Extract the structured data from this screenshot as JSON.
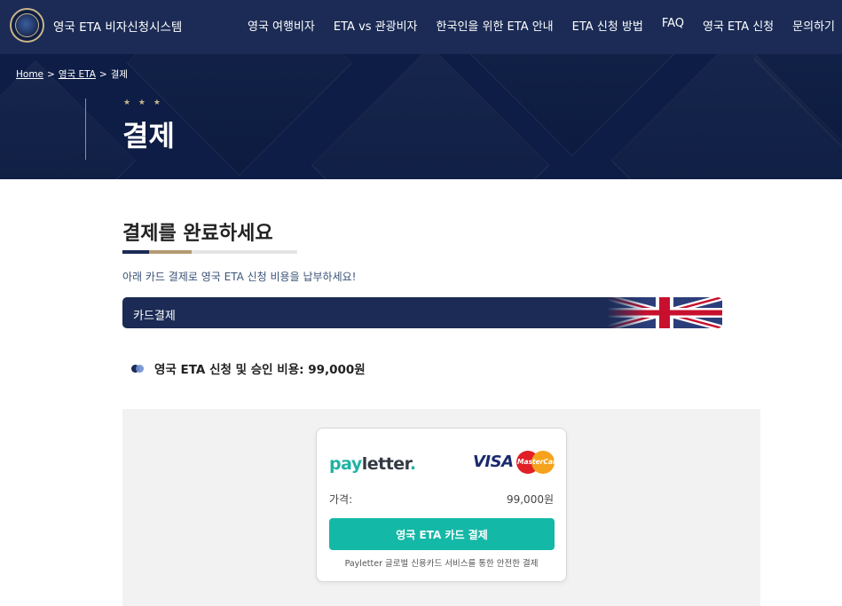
{
  "header": {
    "brand": "영국 ETA 비자신청시스템",
    "nav": [
      "영국 여행비자",
      "ETA vs 관광비자",
      "한국인을 위한 ETA 안내",
      "ETA 신청 방법",
      "FAQ",
      "영국 ETA 신청",
      "문의하기"
    ]
  },
  "hero": {
    "breadcrumb": {
      "home": "Home",
      "sep": ">",
      "eta": "영국 ETA",
      "current": "결제"
    },
    "stars": "★ ★ ★",
    "title": "결제"
  },
  "main": {
    "title": "결제를 완료하세요",
    "description": "아래 카드 결제로 영국 ETA 신청 비용을 납부하세요!",
    "card_section_label": "카드결제",
    "fee_text": "영국 ETA 신청 및 승인 비용: 99,000원"
  },
  "payment": {
    "provider_pay": "pay",
    "provider_letter": "letter",
    "provider_dot": ".",
    "visa": "VISA",
    "mastercard": "MasterCard",
    "price_label": "가격:",
    "price_value": "99,000원",
    "button_label": "영국 ETA 카드 결제",
    "note": "Payletter 글로벌 신용카드 서비스를 통한 안전한 결제"
  },
  "colors": {
    "navy": "#1b2b55",
    "hero": "#0d1d45",
    "gold": "#b39b72",
    "teal": "#14b8a6"
  }
}
